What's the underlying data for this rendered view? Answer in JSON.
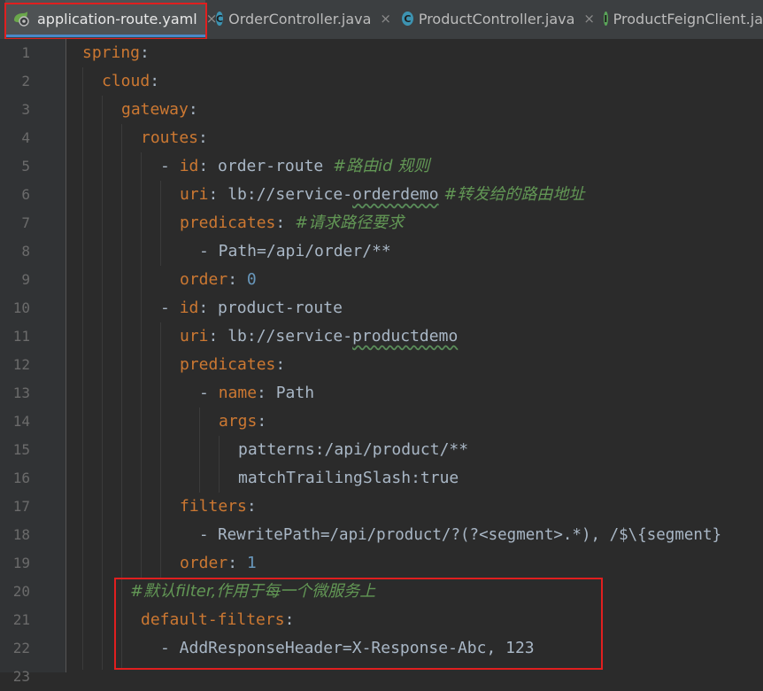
{
  "tabs": [
    {
      "label": "application-route.yaml",
      "icon": "yaml-spring-icon",
      "active": true
    },
    {
      "label": "OrderController.java",
      "icon": "class-icon",
      "letter": "C"
    },
    {
      "label": "ProductController.java",
      "icon": "class-icon",
      "letter": "C"
    },
    {
      "label": "ProductFeignClient.ja",
      "icon": "interface-icon",
      "letter": "I"
    }
  ],
  "close_glyph": "×",
  "line_numbers": [
    "1",
    "2",
    "3",
    "4",
    "5",
    "6",
    "7",
    "8",
    "9",
    "10",
    "11",
    "12",
    "13",
    "14",
    "15",
    "16",
    "17",
    "18",
    "19",
    "20",
    "21",
    "22",
    "23"
  ],
  "code": {
    "l1_key": "spring",
    "l1_colon": ":",
    "l2_key": "cloud",
    "l2_colon": ":",
    "l3_key": "gateway",
    "l3_colon": ":",
    "l4_key": "routes",
    "l4_colon": ":",
    "l5_dash": "- ",
    "l5_key": "id",
    "l5_val": ": order-route ",
    "l5_comment": "#路由id 规则",
    "l6_key": "uri",
    "l6_val1": ": lb://service-",
    "l6_val2": "orderdemo",
    "l6_comment": " #转发给的路由地址",
    "l7_key": "predicates",
    "l7_colon": ": ",
    "l7_comment": "#请求路径要求",
    "l8_text": "- Path=/api/order/**",
    "l9_key": "order",
    "l9_colon": ": ",
    "l9_num": "0",
    "l10_dash": "- ",
    "l10_key": "id",
    "l10_val": ": product-route",
    "l11_key": "uri",
    "l11_val1": ": lb://service-",
    "l11_val2": "productdemo",
    "l12_key": "predicates",
    "l12_colon": ":",
    "l13_dash": "- ",
    "l13_key": "name",
    "l13_val": ": Path",
    "l14_key": "args",
    "l14_colon": ":",
    "l15_text": "patterns:/api/product/**",
    "l16_text": "matchTrailingSlash:true",
    "l17_key": "filters",
    "l17_colon": ":",
    "l18_text": "- RewritePath=/api/product/?(?<segment>.*), /$\\{segment}",
    "l19_key": "order",
    "l19_colon": ": ",
    "l19_num": "1",
    "l20_comment": "#默认filter,作用于每一个微服务上",
    "l21_key": "default-filters",
    "l21_colon": ":",
    "l22_text": "- AddResponseHeader=X-Response-Abc, 123"
  }
}
